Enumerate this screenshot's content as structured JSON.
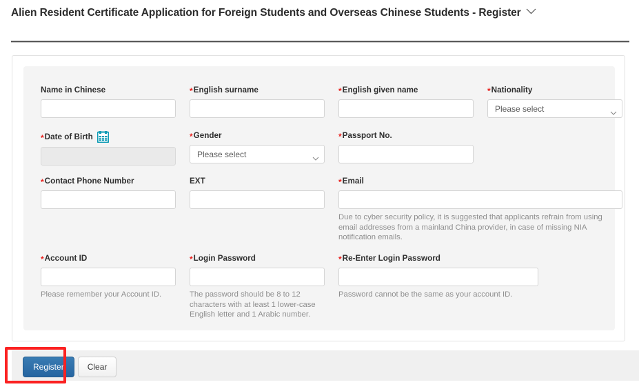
{
  "header": {
    "title": "Alien Resident Certificate Application for Foreign Students and Overseas Chinese Students - Register",
    "chevron_icon": "chevron-down-icon"
  },
  "form": {
    "fields": {
      "name_chinese": {
        "label": "Name in Chinese",
        "required": false,
        "value": "",
        "placeholder": ""
      },
      "english_surname": {
        "label": "English surname",
        "required": true,
        "value": "",
        "placeholder": ""
      },
      "english_given_name": {
        "label": "English given name",
        "required": true,
        "value": "",
        "placeholder": ""
      },
      "nationality": {
        "label": "Nationality",
        "required": true,
        "selected": "Please select",
        "options": [
          "Please select"
        ],
        "chevron_icon": "chevron-down-icon"
      },
      "date_of_birth": {
        "label": "Date of Birth",
        "required": true,
        "value": "",
        "placeholder": "",
        "disabled": true,
        "icon": "calendar-icon"
      },
      "gender": {
        "label": "Gender",
        "required": true,
        "selected": "Please select",
        "options": [
          "Please select"
        ],
        "chevron_icon": "chevron-down-icon"
      },
      "passport_no": {
        "label": "Passport No.",
        "required": true,
        "value": "",
        "placeholder": ""
      },
      "contact_phone": {
        "label": "Contact Phone Number",
        "required": true,
        "value": "",
        "placeholder": ""
      },
      "ext": {
        "label": "EXT",
        "required": false,
        "value": "",
        "placeholder": ""
      },
      "email": {
        "label": "Email",
        "required": true,
        "value": "",
        "placeholder": "",
        "hint": "Due to cyber security policy, it is suggested that applicants refrain from using email addresses from a mainland China provider, in case of missing NIA notification emails."
      },
      "account_id": {
        "label": "Account ID",
        "required": true,
        "value": "",
        "placeholder": "",
        "hint": "Please remember your Account ID."
      },
      "login_password": {
        "label": "Login Password",
        "required": true,
        "value": "",
        "placeholder": "",
        "hint": "The password should be 8 to 12 characters with at least 1 lower-case English letter and 1 Arabic number."
      },
      "reenter_password": {
        "label": "Re-Enter Login Password",
        "required": true,
        "value": "",
        "placeholder": "",
        "hint": "Password cannot be the same as your account ID."
      }
    },
    "required_marker": "*"
  },
  "footer": {
    "register_label": "Register",
    "clear_label": "Clear"
  },
  "colors": {
    "required_asterisk": "#e8231f",
    "primary_button": "#2b6ca3",
    "highlight_box": "#fb2222",
    "calendar_icon": "#0f9bb5",
    "panel_background": "#f4f4f4"
  }
}
